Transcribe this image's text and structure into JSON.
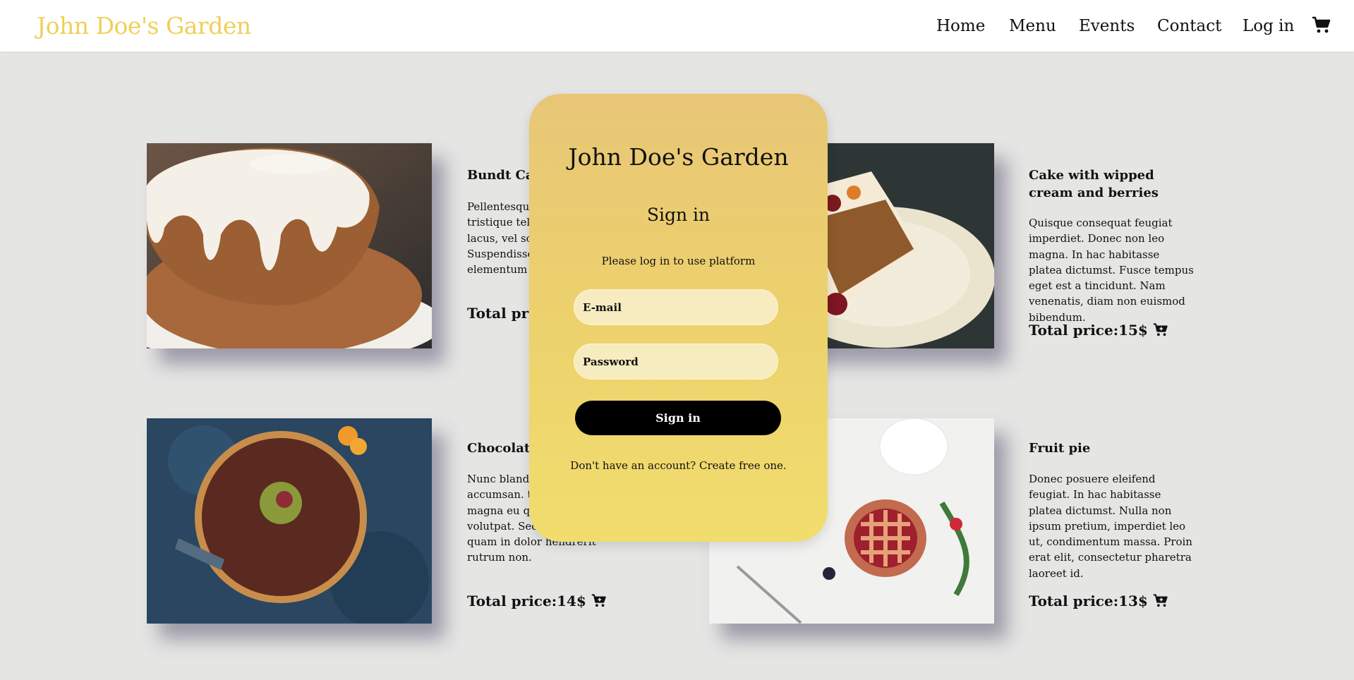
{
  "header": {
    "brand": "John Doe's Garden",
    "nav": [
      "Home",
      "Menu",
      "Events",
      "Contact",
      "Log in"
    ]
  },
  "products": [
    {
      "title": "Bundt Cake",
      "description": "Pellentesque habitant morbi tristique tellus. Sed in ornare lacus, vel sollicitudin mi. Suspendisse consectetur. elementum nibh.",
      "price": "Total price:12$"
    },
    {
      "title": "Cake with wipped cream and berries",
      "description": "Quisque consequat feugiat imperdiet. Donec non leo magna. In hac habitasse platea dictumst. Fusce tempus eget est a tincidunt. Nam venenatis, diam non euismod bibendum.",
      "price": "Total price:15$"
    },
    {
      "title": "Chocolate tart",
      "description": "Nunc blandit fringilla accumsan. tristique nibh magna eu quam. ut orci in volutpat. Sed sodales.Nam at quam in dolor hendrerit rutrum non.",
      "price": "Total price:14$"
    },
    {
      "title": "Fruit pie",
      "description": "Donec posuere eleifend feugiat. In hac habitasse platea dictumst. Nulla non ipsum pretium, imperdiet leo ut, condimentum massa. Proin erat elit, consectetur pharetra laoreet id.",
      "price": "Total price:13$"
    }
  ],
  "signin": {
    "title": "John Doe's Garden",
    "heading": "Sign in",
    "note": "Please log in to use platform",
    "email_placeholder": "E-mail",
    "password_placeholder": "Password",
    "button": "Sign in",
    "footer": "Don't have an account? Create free one."
  },
  "icons": {
    "cart": "cart-icon"
  },
  "colors": {
    "brand": "#f0cf5a",
    "overlay": "#ecd06d",
    "background": "#e5e5e4"
  }
}
